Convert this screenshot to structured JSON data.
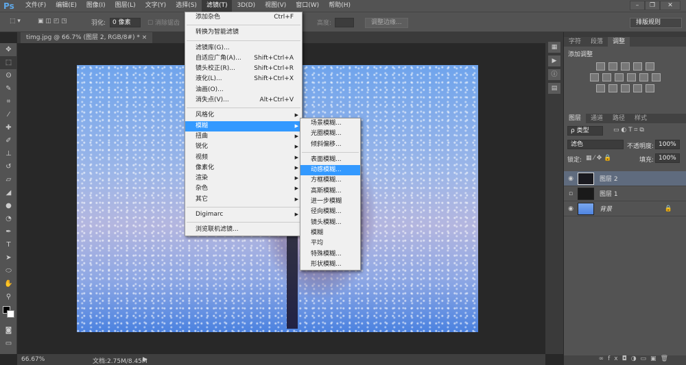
{
  "menubar": {
    "logo": "Ps",
    "items": [
      "文件(F)",
      "编辑(E)",
      "图像(I)",
      "图层(L)",
      "文字(Y)",
      "选择(S)",
      "滤镜(T)",
      "3D(D)",
      "视图(V)",
      "窗口(W)",
      "帮助(H)"
    ],
    "active": "滤镜(T)"
  },
  "window": {
    "min": "–",
    "restore": "❐",
    "close": "✕"
  },
  "options": {
    "feather_label": "羽化:",
    "feather_value": "0 像素",
    "antialias": "消除锯齿",
    "height_label": "高度:",
    "refine_edge": "调整边缘...",
    "workspace": "排版规则"
  },
  "document": {
    "tab": "timg.jpg @ 66.7% (图层 2, RGB/8#) *",
    "close": "×"
  },
  "filter_menu": {
    "items": [
      {
        "label": "添加杂色",
        "shortcut": "Ctrl+F"
      },
      {
        "label": "转换为智能滤镜"
      },
      {
        "label": "滤镜库(G)..."
      },
      {
        "label": "自适应广角(A)...",
        "shortcut": "Shift+Ctrl+A"
      },
      {
        "label": "镜头校正(R)...",
        "shortcut": "Shift+Ctrl+R"
      },
      {
        "label": "液化(L)...",
        "shortcut": "Shift+Ctrl+X"
      },
      {
        "label": "油画(O)..."
      },
      {
        "label": "消失点(V)...",
        "shortcut": "Alt+Ctrl+V"
      },
      {
        "label": "风格化"
      },
      {
        "label": "模糊"
      },
      {
        "label": "扭曲"
      },
      {
        "label": "锐化"
      },
      {
        "label": "视频"
      },
      {
        "label": "像素化"
      },
      {
        "label": "渲染"
      },
      {
        "label": "杂色"
      },
      {
        "label": "其它"
      },
      {
        "label": "Digimarc"
      },
      {
        "label": "浏览联机滤镜..."
      }
    ],
    "highlighted": "模糊"
  },
  "blur_menu": {
    "items": [
      "场景模糊...",
      "光圈模糊...",
      "倾斜偏移...",
      "表面模糊...",
      "动感模糊...",
      "方框模糊...",
      "高斯模糊...",
      "进一步模糊",
      "径向模糊...",
      "镜头模糊...",
      "模糊",
      "平均",
      "特殊模糊...",
      "形状模糊..."
    ],
    "highlighted": "动感模糊..."
  },
  "adjust_panel": {
    "tabs": [
      "字符",
      "段落",
      "调整"
    ],
    "active": "调整",
    "title": "添加调整"
  },
  "layers_panel": {
    "tabs": [
      "图层",
      "通道",
      "路径",
      "样式"
    ],
    "active": "图层",
    "filter": "ρ 类型",
    "blend_mode": "滤色",
    "opacity_label": "不透明度:",
    "opacity": "100%",
    "lock_label": "锁定:",
    "fill_label": "填充:",
    "fill": "100%",
    "layers": [
      {
        "name": "图层 2",
        "visible": true,
        "selected": true
      },
      {
        "name": "图层 1",
        "visible": false
      },
      {
        "name": "背景",
        "visible": true,
        "locked": true
      }
    ]
  },
  "status": {
    "zoom": "66.67%",
    "doc": "文档:2.75M/8.45M"
  },
  "colors": {
    "highlight": "#3399ff",
    "ui": "#535353"
  }
}
